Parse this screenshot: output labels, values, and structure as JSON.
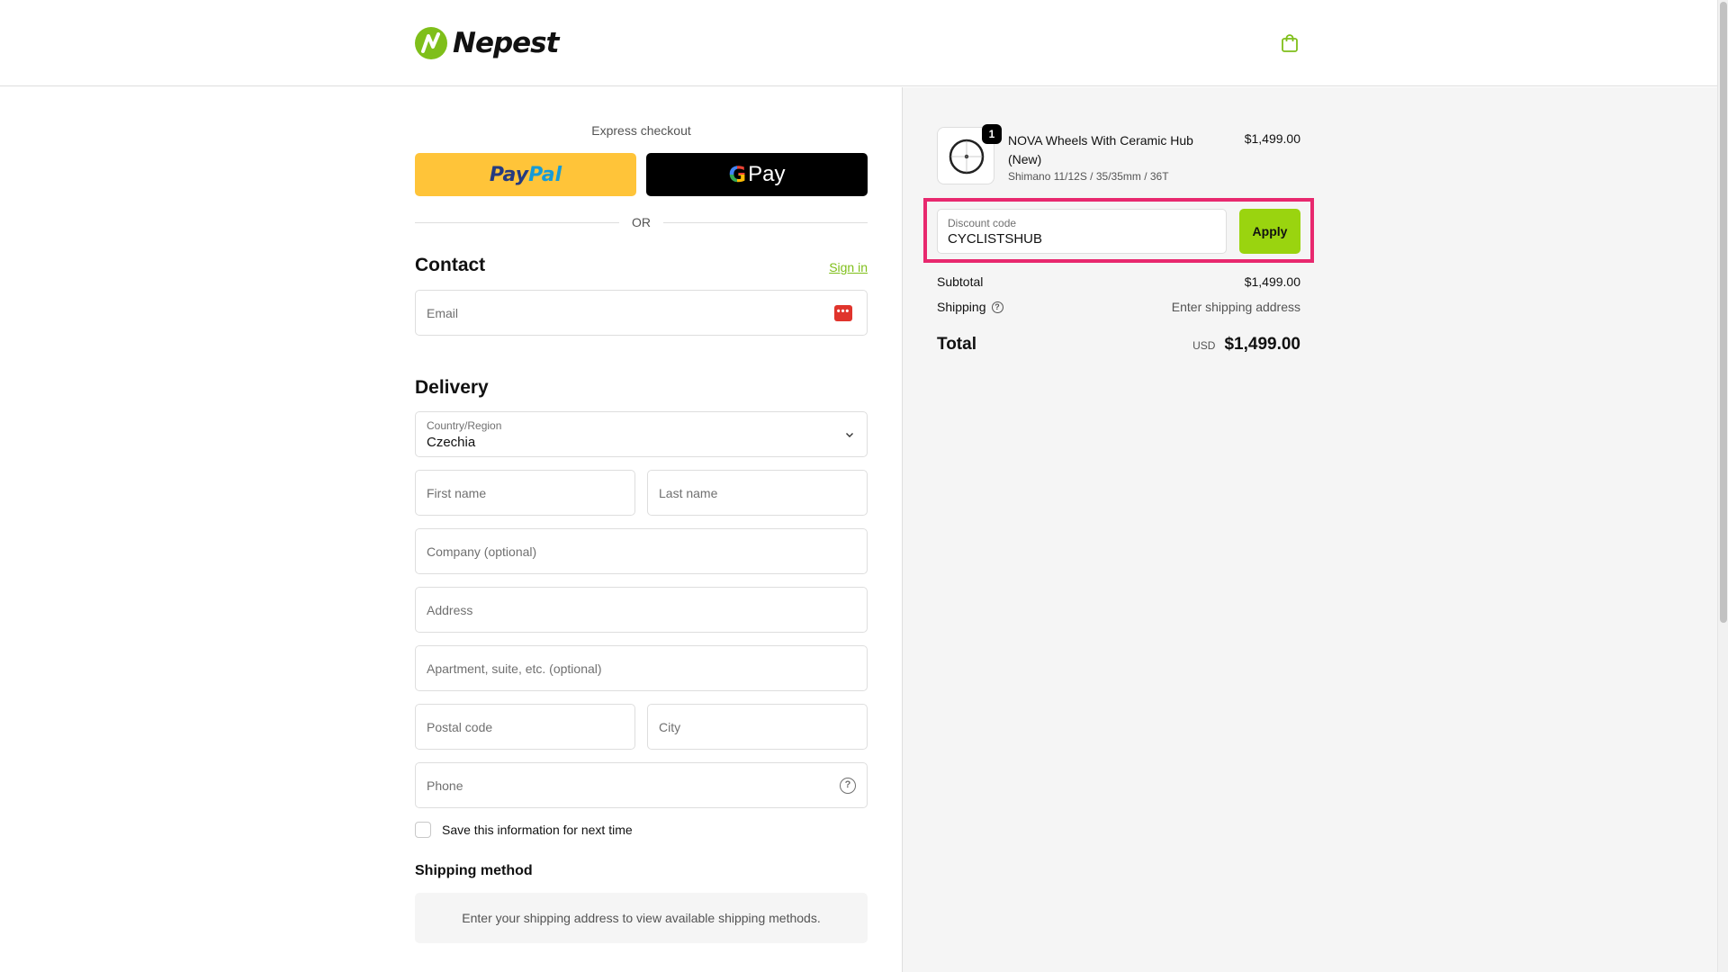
{
  "header": {
    "brand": "Nepest",
    "cart_icon": "shopping-bag-icon"
  },
  "express": {
    "label": "Express checkout",
    "paypal_part1": "Pay",
    "paypal_part2": "Pal",
    "gpay_g": "G",
    "gpay_text": "Pay",
    "or_text": "OR"
  },
  "contact": {
    "title": "Contact",
    "signin": "Sign in",
    "email_placeholder": "Email",
    "email_icon": "password-manager-icon"
  },
  "delivery": {
    "title": "Delivery",
    "country_label": "Country/Region",
    "country_value": "Czechia",
    "first_name": "First name",
    "last_name": "Last name",
    "company": "Company (optional)",
    "address": "Address",
    "apartment": "Apartment, suite, etc. (optional)",
    "postal_code": "Postal code",
    "city": "City",
    "phone": "Phone",
    "save_info": "Save this information for next time"
  },
  "shipping_method": {
    "title": "Shipping method",
    "note": "Enter your shipping address to view available shipping methods."
  },
  "summary": {
    "product": {
      "quantity": "1",
      "name": "NOVA Wheels With Ceramic Hub (New)",
      "variant": "Shimano 11/12S / 35/35mm / 36T",
      "price": "$1,499.00"
    },
    "discount": {
      "label": "Discount code",
      "value": "CYCLISTSHUB",
      "apply": "Apply"
    },
    "subtotal_label": "Subtotal",
    "subtotal_value": "$1,499.00",
    "shipping_label": "Shipping",
    "shipping_value": "Enter shipping address",
    "total_label": "Total",
    "currency": "USD",
    "total_value": "$1,499.00"
  },
  "colors": {
    "accent": "#7fbf1a",
    "apply_button": "#9ad40f",
    "highlight": "#e8286e",
    "paypal": "#ffc439"
  }
}
